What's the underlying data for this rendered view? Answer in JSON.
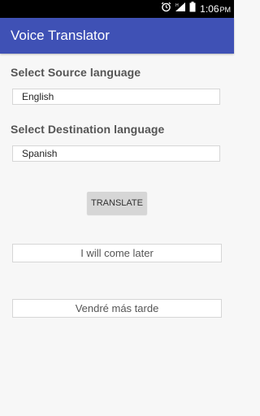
{
  "status_bar": {
    "time": "1:06",
    "ampm": "PM",
    "icons": [
      "alarm-icon",
      "signal-icon",
      "battery-icon"
    ]
  },
  "app_bar": {
    "title": "Voice Translator",
    "color": "#3f51b5"
  },
  "source": {
    "label": "Select Source language",
    "value": "English"
  },
  "destination": {
    "label": "Select Destination language",
    "value": "Spanish"
  },
  "translate_button": {
    "label": "TRANSLATE"
  },
  "input_text": "I will come later",
  "output_text": "Vendré más tarde"
}
